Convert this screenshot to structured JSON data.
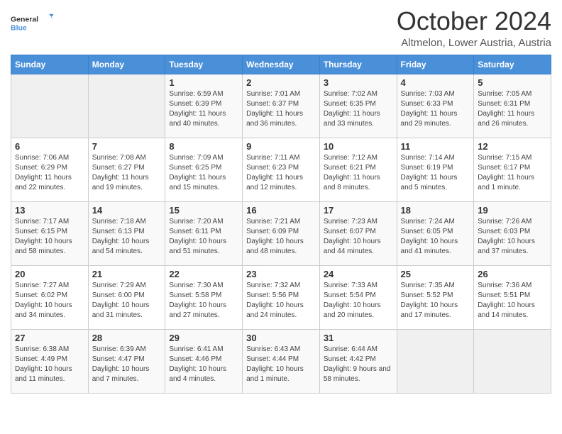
{
  "logo": {
    "line1": "General",
    "line2": "Blue"
  },
  "header": {
    "month": "October 2024",
    "location": "Altmelon, Lower Austria, Austria"
  },
  "weekdays": [
    "Sunday",
    "Monday",
    "Tuesday",
    "Wednesday",
    "Thursday",
    "Friday",
    "Saturday"
  ],
  "weeks": [
    [
      {
        "day": "",
        "info": ""
      },
      {
        "day": "",
        "info": ""
      },
      {
        "day": "1",
        "info": "Sunrise: 6:59 AM\nSunset: 6:39 PM\nDaylight: 11 hours and 40 minutes."
      },
      {
        "day": "2",
        "info": "Sunrise: 7:01 AM\nSunset: 6:37 PM\nDaylight: 11 hours and 36 minutes."
      },
      {
        "day": "3",
        "info": "Sunrise: 7:02 AM\nSunset: 6:35 PM\nDaylight: 11 hours and 33 minutes."
      },
      {
        "day": "4",
        "info": "Sunrise: 7:03 AM\nSunset: 6:33 PM\nDaylight: 11 hours and 29 minutes."
      },
      {
        "day": "5",
        "info": "Sunrise: 7:05 AM\nSunset: 6:31 PM\nDaylight: 11 hours and 26 minutes."
      }
    ],
    [
      {
        "day": "6",
        "info": "Sunrise: 7:06 AM\nSunset: 6:29 PM\nDaylight: 11 hours and 22 minutes."
      },
      {
        "day": "7",
        "info": "Sunrise: 7:08 AM\nSunset: 6:27 PM\nDaylight: 11 hours and 19 minutes."
      },
      {
        "day": "8",
        "info": "Sunrise: 7:09 AM\nSunset: 6:25 PM\nDaylight: 11 hours and 15 minutes."
      },
      {
        "day": "9",
        "info": "Sunrise: 7:11 AM\nSunset: 6:23 PM\nDaylight: 11 hours and 12 minutes."
      },
      {
        "day": "10",
        "info": "Sunrise: 7:12 AM\nSunset: 6:21 PM\nDaylight: 11 hours and 8 minutes."
      },
      {
        "day": "11",
        "info": "Sunrise: 7:14 AM\nSunset: 6:19 PM\nDaylight: 11 hours and 5 minutes."
      },
      {
        "day": "12",
        "info": "Sunrise: 7:15 AM\nSunset: 6:17 PM\nDaylight: 11 hours and 1 minute."
      }
    ],
    [
      {
        "day": "13",
        "info": "Sunrise: 7:17 AM\nSunset: 6:15 PM\nDaylight: 10 hours and 58 minutes."
      },
      {
        "day": "14",
        "info": "Sunrise: 7:18 AM\nSunset: 6:13 PM\nDaylight: 10 hours and 54 minutes."
      },
      {
        "day": "15",
        "info": "Sunrise: 7:20 AM\nSunset: 6:11 PM\nDaylight: 10 hours and 51 minutes."
      },
      {
        "day": "16",
        "info": "Sunrise: 7:21 AM\nSunset: 6:09 PM\nDaylight: 10 hours and 48 minutes."
      },
      {
        "day": "17",
        "info": "Sunrise: 7:23 AM\nSunset: 6:07 PM\nDaylight: 10 hours and 44 minutes."
      },
      {
        "day": "18",
        "info": "Sunrise: 7:24 AM\nSunset: 6:05 PM\nDaylight: 10 hours and 41 minutes."
      },
      {
        "day": "19",
        "info": "Sunrise: 7:26 AM\nSunset: 6:03 PM\nDaylight: 10 hours and 37 minutes."
      }
    ],
    [
      {
        "day": "20",
        "info": "Sunrise: 7:27 AM\nSunset: 6:02 PM\nDaylight: 10 hours and 34 minutes."
      },
      {
        "day": "21",
        "info": "Sunrise: 7:29 AM\nSunset: 6:00 PM\nDaylight: 10 hours and 31 minutes."
      },
      {
        "day": "22",
        "info": "Sunrise: 7:30 AM\nSunset: 5:58 PM\nDaylight: 10 hours and 27 minutes."
      },
      {
        "day": "23",
        "info": "Sunrise: 7:32 AM\nSunset: 5:56 PM\nDaylight: 10 hours and 24 minutes."
      },
      {
        "day": "24",
        "info": "Sunrise: 7:33 AM\nSunset: 5:54 PM\nDaylight: 10 hours and 20 minutes."
      },
      {
        "day": "25",
        "info": "Sunrise: 7:35 AM\nSunset: 5:52 PM\nDaylight: 10 hours and 17 minutes."
      },
      {
        "day": "26",
        "info": "Sunrise: 7:36 AM\nSunset: 5:51 PM\nDaylight: 10 hours and 14 minutes."
      }
    ],
    [
      {
        "day": "27",
        "info": "Sunrise: 6:38 AM\nSunset: 4:49 PM\nDaylight: 10 hours and 11 minutes."
      },
      {
        "day": "28",
        "info": "Sunrise: 6:39 AM\nSunset: 4:47 PM\nDaylight: 10 hours and 7 minutes."
      },
      {
        "day": "29",
        "info": "Sunrise: 6:41 AM\nSunset: 4:46 PM\nDaylight: 10 hours and 4 minutes."
      },
      {
        "day": "30",
        "info": "Sunrise: 6:43 AM\nSunset: 4:44 PM\nDaylight: 10 hours and 1 minute."
      },
      {
        "day": "31",
        "info": "Sunrise: 6:44 AM\nSunset: 4:42 PM\nDaylight: 9 hours and 58 minutes."
      },
      {
        "day": "",
        "info": ""
      },
      {
        "day": "",
        "info": ""
      }
    ]
  ]
}
